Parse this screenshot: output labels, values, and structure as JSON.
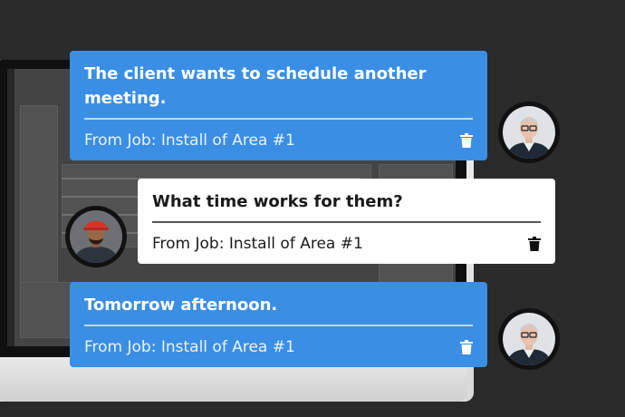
{
  "colors": {
    "background": "#2a2a2a",
    "bubble_blue": "#3a8ee4",
    "bubble_white": "#ffffff"
  },
  "messages": [
    {
      "text": "The client wants to schedule another meeting.",
      "source": "From Job: Install of Area #1",
      "icon": "trash-icon"
    },
    {
      "text": "What time works for them?",
      "source": "From Job: Install of Area #1",
      "icon": "trash-icon"
    },
    {
      "text": "Tomorrow afternoon.",
      "source": "From Job: Install of Area #1",
      "icon": "trash-icon"
    }
  ]
}
